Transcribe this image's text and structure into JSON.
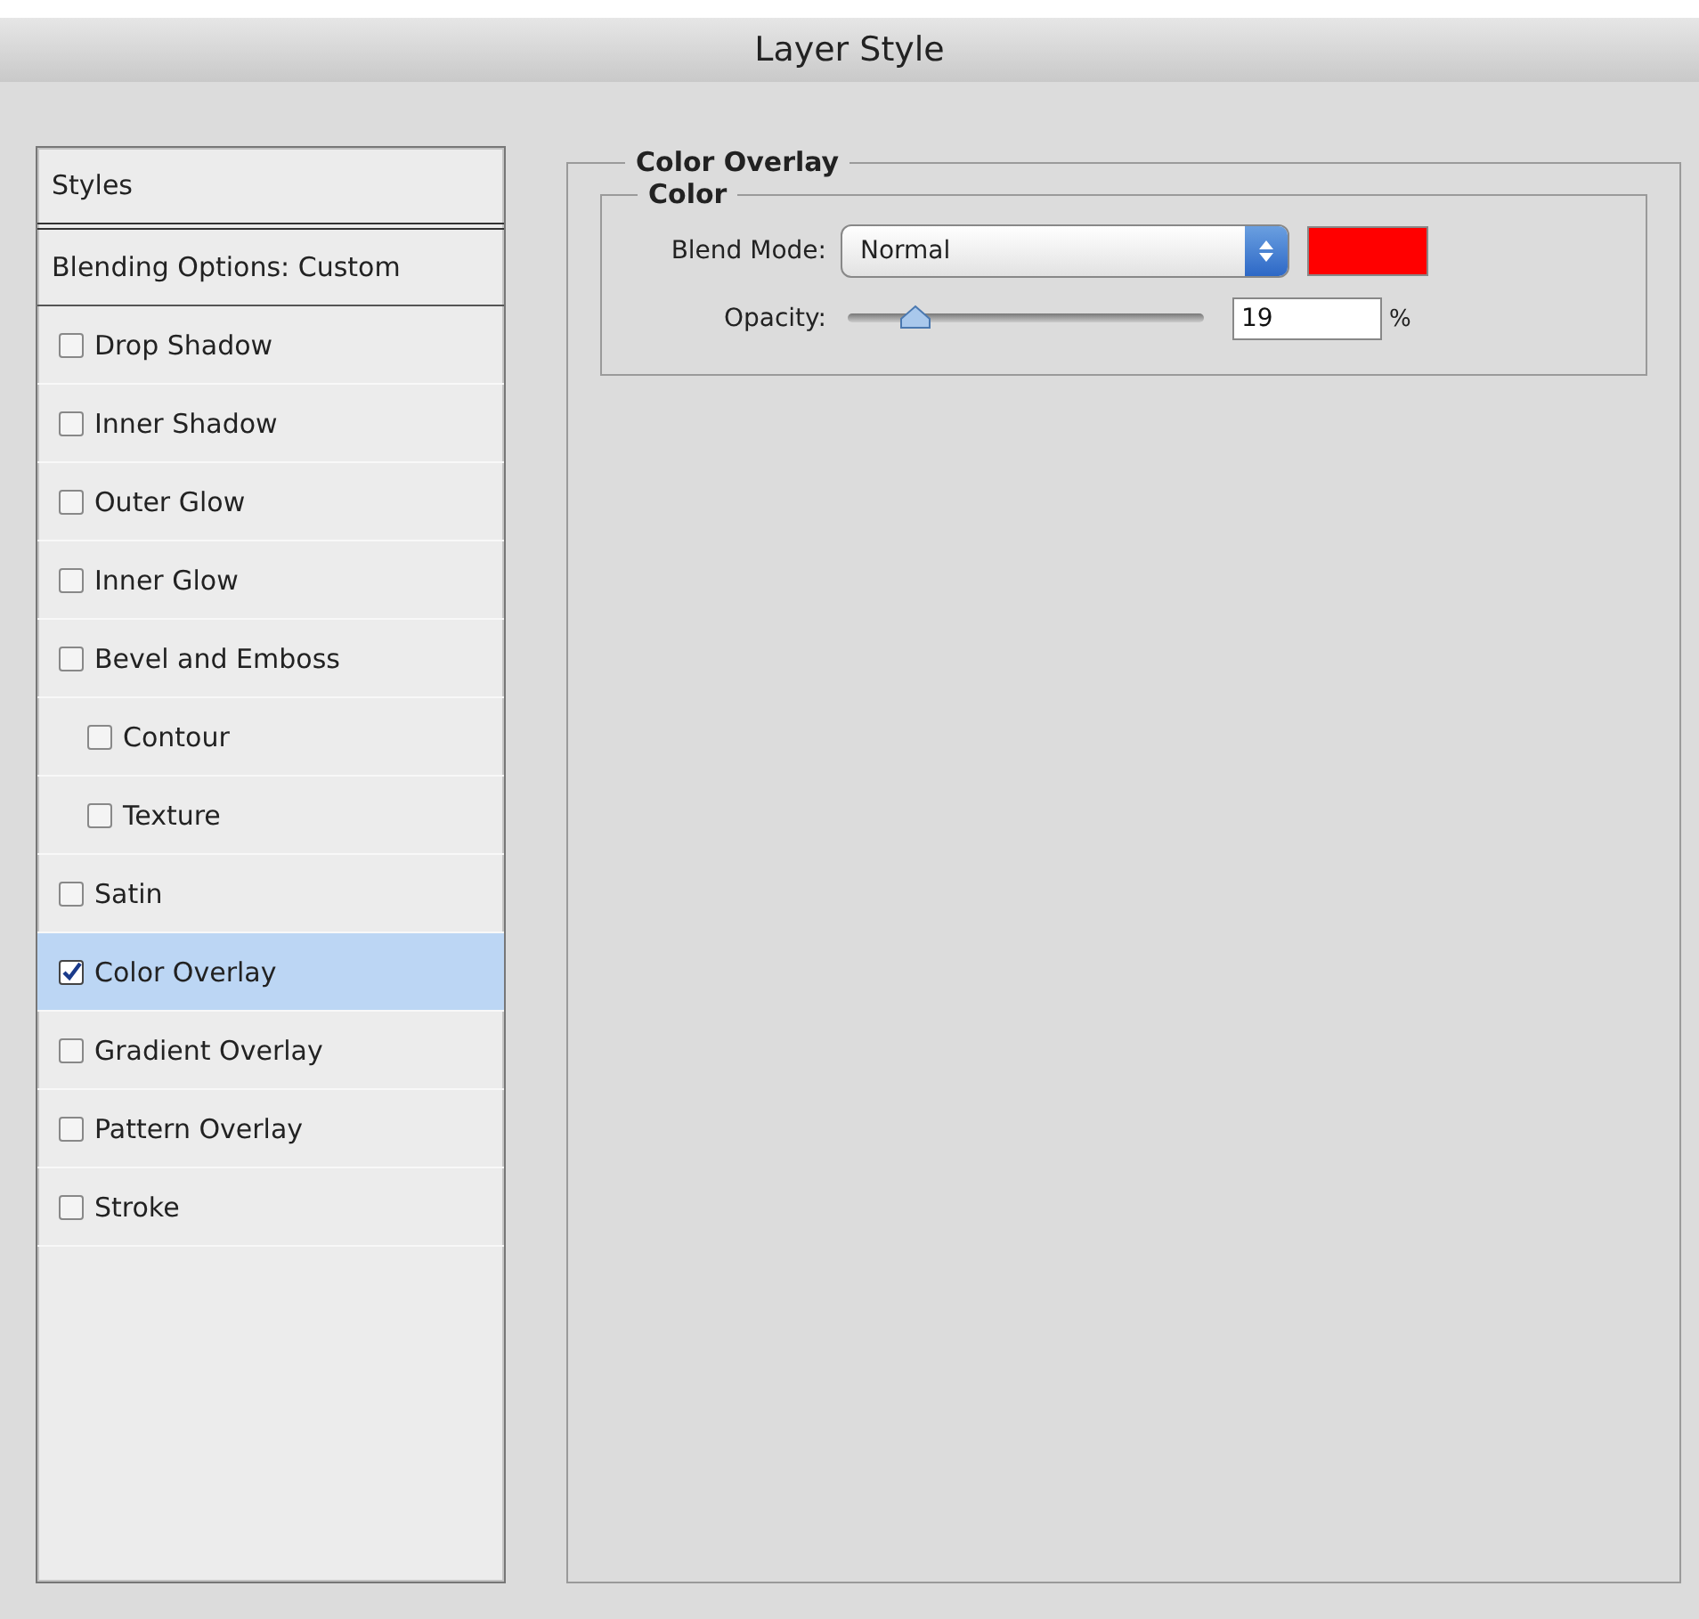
{
  "window": {
    "title": "Layer Style"
  },
  "styles_header": "Styles",
  "blending_options": "Blending Options: Custom",
  "effects": [
    {
      "label": "Drop Shadow",
      "checked": false,
      "selected": false
    },
    {
      "label": "Inner Shadow",
      "checked": false,
      "selected": false
    },
    {
      "label": "Outer Glow",
      "checked": false,
      "selected": false
    },
    {
      "label": "Inner Glow",
      "checked": false,
      "selected": false
    },
    {
      "label": "Bevel and Emboss",
      "checked": false,
      "selected": false,
      "children": [
        {
          "label": "Contour",
          "checked": false,
          "selected": false
        },
        {
          "label": "Texture",
          "checked": false,
          "selected": false
        }
      ]
    },
    {
      "label": "Satin",
      "checked": false,
      "selected": false
    },
    {
      "label": "Color Overlay",
      "checked": true,
      "selected": true
    },
    {
      "label": "Gradient Overlay",
      "checked": false,
      "selected": false
    },
    {
      "label": "Pattern Overlay",
      "checked": false,
      "selected": false
    },
    {
      "label": "Stroke",
      "checked": false,
      "selected": false
    }
  ],
  "panel": {
    "title": "Color Overlay",
    "group_title": "Color",
    "blend_mode": {
      "label": "Blend Mode:",
      "value": "Normal"
    },
    "color_swatch": {
      "color": "#ff0000"
    },
    "opacity": {
      "label": "Opacity:",
      "level": 0.19,
      "value": "19",
      "unit": "%"
    }
  }
}
